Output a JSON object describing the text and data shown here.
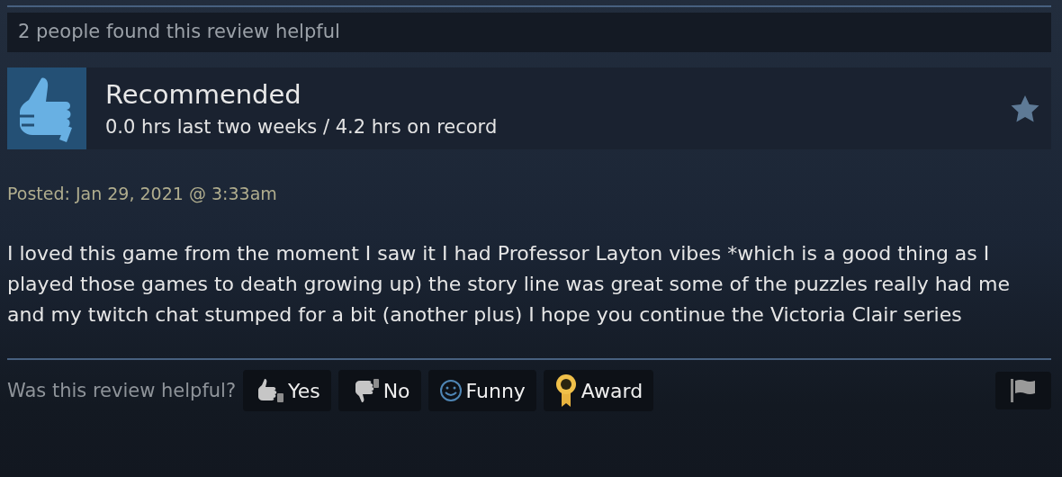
{
  "helpful_count": "2 people found this review helpful",
  "review": {
    "verdict": "Recommended",
    "hours": "0.0 hrs last two weeks / 4.2 hrs on record",
    "posted": "Posted: Jan 29, 2021 @ 3:33am",
    "body": "I loved this game from the moment I saw it I had Professor Layton vibes *which is a good thing as I played those games to death growing up) the story line was great some of the puzzles really had me and my twitch chat stumped for a bit (another plus) I hope you continue the Victoria Clair series"
  },
  "footer": {
    "question": "Was this review helpful?",
    "buttons": [
      {
        "kind": "yes",
        "label": "Yes"
      },
      {
        "kind": "no",
        "label": "No"
      },
      {
        "kind": "funny",
        "label": "Funny"
      },
      {
        "kind": "award",
        "label": "Award"
      }
    ]
  }
}
